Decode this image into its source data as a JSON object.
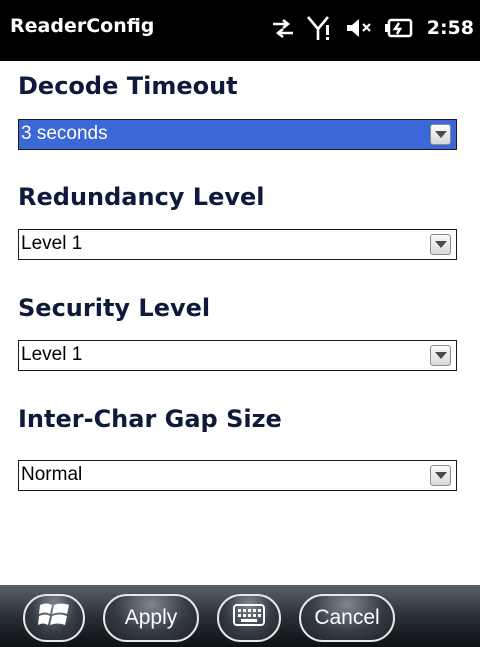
{
  "app": {
    "title": "ReaderConfig"
  },
  "status_bar": {
    "time": "2:58",
    "icons": [
      "data-sync-icon",
      "signal-icon",
      "volume-muted-icon",
      "battery-charging-icon"
    ]
  },
  "fields": [
    {
      "label": "Decode Timeout",
      "value": "3 seconds",
      "selected": true
    },
    {
      "label": "Redundancy Level",
      "value": "Level 1",
      "selected": false
    },
    {
      "label": "Security Level",
      "value": "Level 1",
      "selected": false
    },
    {
      "label": "Inter-Char Gap Size",
      "value": "Normal",
      "selected": false
    }
  ],
  "taskbar": {
    "apply_label": "Apply",
    "cancel_label": "Cancel"
  },
  "colors": {
    "selection": "#3b68d6",
    "label_text": "#0d1a3a",
    "titlebar": "#000000"
  }
}
